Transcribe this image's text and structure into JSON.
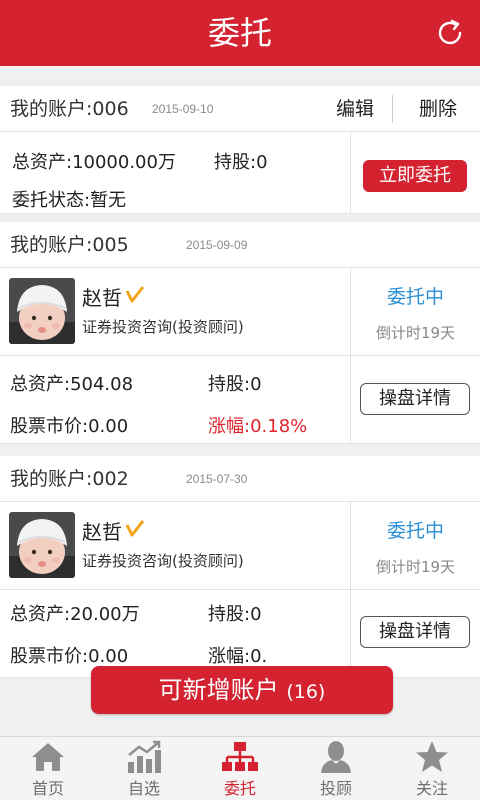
{
  "header": {
    "title": "委托",
    "refresh_icon": "refresh-icon"
  },
  "accounts": [
    {
      "label": "我的账户:006",
      "date": "2015-09-10",
      "edit": "编辑",
      "delete": "删除",
      "total_assets": "总资产:10000.00万",
      "holdings": "持股:0",
      "entrust_status": "委托状态:暂无",
      "action": "立即委托"
    },
    {
      "label": "我的账户:005",
      "date": "2015-09-09",
      "advisor_name": "赵哲",
      "advisor_role": "证券投资咨询(投资顾问)",
      "status": "委托中",
      "countdown": "倒计时19天",
      "total_assets": "总资产:504.08",
      "holdings": "持股:0",
      "market_value": "股票市价:0.00",
      "change": "涨幅:0.18%",
      "action": "操盘详情"
    },
    {
      "label": "我的账户:002",
      "date": "2015-07-30",
      "advisor_name": "赵哲",
      "advisor_role": "证券投资咨询(投资顾问)",
      "status": "委托中",
      "countdown": "倒计时19天",
      "total_assets": "总资产:20.00万",
      "holdings": "持股:0",
      "market_value": "股票市价:0.00",
      "change": "涨幅:0.",
      "action": "操盘详情"
    }
  ],
  "add_account": {
    "label": "可新增账户",
    "count": "(16)"
  },
  "tabs": [
    {
      "label": "首页",
      "icon": "home-icon"
    },
    {
      "label": "自选",
      "icon": "chart-icon"
    },
    {
      "label": "委托",
      "icon": "org-chart-icon",
      "active": true
    },
    {
      "label": "投顾",
      "icon": "person-icon"
    },
    {
      "label": "关注",
      "icon": "star-icon"
    }
  ],
  "colors": {
    "brand_red": "#d42230",
    "status_blue": "#2b8fd6",
    "verified_gold": "#f2a51a"
  }
}
